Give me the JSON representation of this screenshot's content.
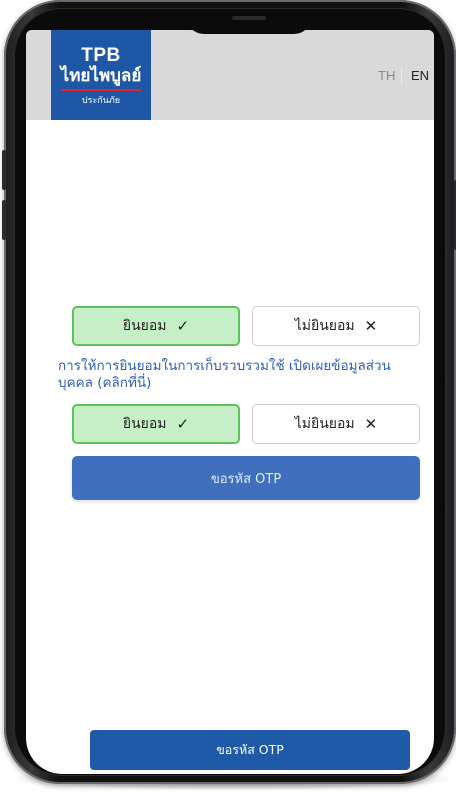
{
  "header": {
    "logo": {
      "line1": "TPB",
      "line2": "ไทยไพบูลย์",
      "line3": "ประกันภัย"
    },
    "languages": [
      {
        "label": "TH",
        "active": false
      },
      {
        "label": "EN",
        "active": true
      }
    ]
  },
  "consent_first": {
    "agree_label": "ยินยอม",
    "agree_symbol": "✓",
    "disagree_label": "ไม่ยินยอม",
    "disagree_symbol": "✕"
  },
  "consent_link_text": "การให้การยินยอมในการเก็บรวบรวมใช้ เปิดเผยข้อมูลส่วนบุคคล (คลิกที่นี่)",
  "consent_second": {
    "agree_label": "ยินยอม",
    "agree_symbol": "✓",
    "disagree_label": "ไม่ยินยอม",
    "disagree_symbol": "✕"
  },
  "otp_button_label": "ขอรหัส OTP",
  "bottom_otp_button_label": "ขอรหัส OTP",
  "colors": {
    "brand_blue": "#1f57a7",
    "agree_green_bg": "#c7efc7",
    "agree_green_border": "#5cc25c",
    "link_blue": "#2d5fb8",
    "header_gray": "#d9d9d9"
  }
}
